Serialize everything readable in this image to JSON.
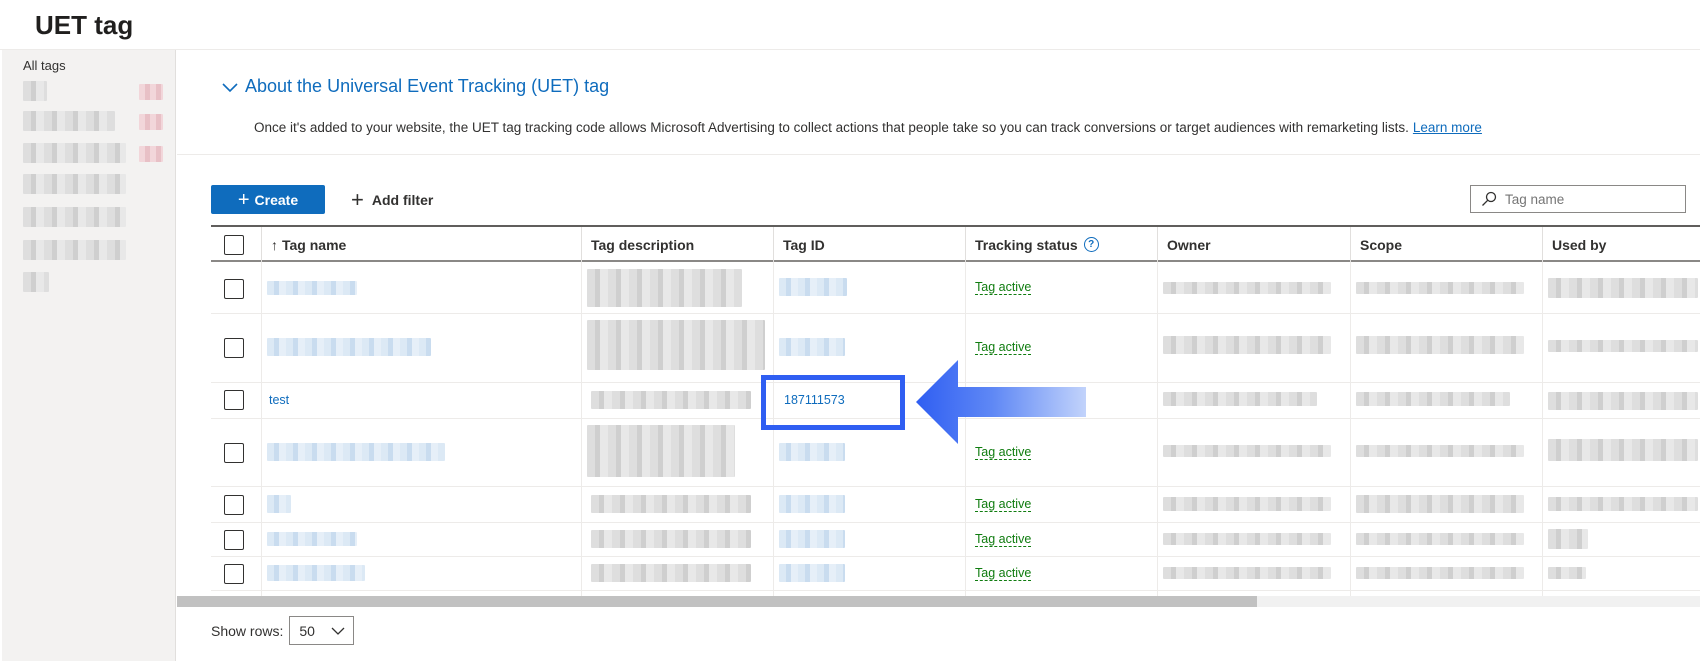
{
  "page": {
    "title": "UET tag"
  },
  "sidebar": {
    "all_tags_label": "All tags"
  },
  "about": {
    "title": "About the Universal Event Tracking (UET) tag",
    "description": "Once it's added to your website, the UET tag tracking code allows Microsoft Advertising to collect actions that people take so you can track conversions or target audiences with remarketing lists.",
    "learn_more": "Learn more"
  },
  "toolbar": {
    "create_label": "Create",
    "add_filter_label": "Add filter",
    "search_placeholder": "Tag name"
  },
  "table": {
    "columns": {
      "tag_name": "Tag name",
      "tag_description": "Tag description",
      "tag_id": "Tag ID",
      "tracking_status": "Tracking status",
      "owner": "Owner",
      "scope": "Scope",
      "used_by": "Used by"
    },
    "rows": [
      {
        "status": "Tag active"
      },
      {
        "status": "Tag active"
      },
      {
        "tag_name": "test",
        "tag_id": "187111573"
      },
      {
        "status": "Tag active"
      },
      {
        "status": "Tag active"
      },
      {
        "status": "Tag active"
      },
      {
        "status": "Tag active"
      }
    ]
  },
  "footer": {
    "show_rows_label": "Show rows:",
    "rows_value": "50"
  },
  "colors": {
    "accent": "#0f6cbd",
    "status_green": "#107c10",
    "annotation_blue": "#2f5ef2"
  },
  "icons": [
    "chevron-down-icon",
    "plus-icon",
    "search-icon",
    "sort-up-icon",
    "help-icon",
    "checkbox-icon",
    "arrow-annotation-icon"
  ]
}
